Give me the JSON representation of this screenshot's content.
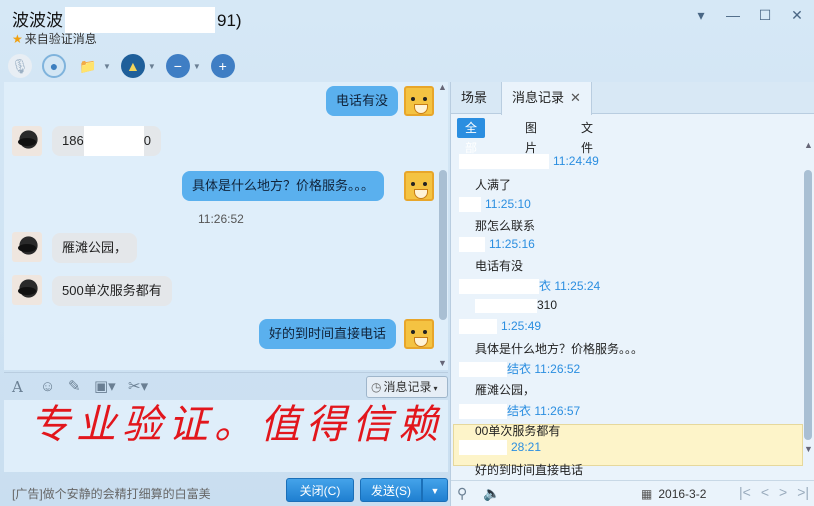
{
  "window": {
    "title_start": "波波波",
    "title_end": "91)",
    "subtitle": "来自验证消息",
    "controls": [
      "▾",
      "—",
      "☐",
      "✕"
    ]
  },
  "toolbar": {
    "icons": [
      "microphone-icon",
      "video-icon",
      "folder-icon",
      "remote-assist-icon",
      "remove-contact-icon",
      "add-contact-icon"
    ]
  },
  "chat": {
    "messages": [
      {
        "from": "me",
        "text": "电话有没"
      },
      {
        "from": "them",
        "text_start": "186",
        "text_end": "0"
      },
      {
        "from": "me",
        "text": "具体是什么地方？价格服务。。。"
      },
      {
        "timestamp": "11:26:52"
      },
      {
        "from": "them",
        "text": "雁滩公园，"
      },
      {
        "from": "them",
        "text": "500单次服务都有"
      },
      {
        "from": "me",
        "text": "好的到时间直接电话"
      }
    ]
  },
  "input": {
    "history_button": "消息记录",
    "overlay_text": "专业验证。值得信赖",
    "ad_text": "[广告]做个安静的会精打细算的白富美",
    "close_button": "关闭(C)",
    "send_button": "发送(S)"
  },
  "history_panel": {
    "tabs": [
      "场景",
      "消息记录"
    ],
    "filters": [
      "全部",
      "图片",
      "文件"
    ],
    "entries": [
      {
        "name": "",
        "time": "11:24:49",
        "text": "人满了"
      },
      {
        "name": "",
        "time": "11:25:10",
        "text": "那怎么联系"
      },
      {
        "name": "",
        "time": "11:25:16",
        "text": "电话有没"
      },
      {
        "name": "衣",
        "time": "11:25:24",
        "text": "310"
      },
      {
        "name": "",
        "time": "1:25:49",
        "text": "具体是什么地方？价格服务。。。"
      },
      {
        "name": "结衣",
        "time": "11:26:52",
        "text": "雁滩公园，"
      },
      {
        "name": "结衣",
        "time": "11:26:57",
        "text": "00单次服务都有"
      },
      {
        "name": "",
        "time": "28:21",
        "text": "好的到时间直接电话"
      }
    ],
    "date": "2016-3-2"
  },
  "colors": {
    "accent": "#2b8ee0",
    "bubble_out": "#5ab0ee",
    "watermark": "#e2161c",
    "highlight": "#fdf4c9"
  }
}
